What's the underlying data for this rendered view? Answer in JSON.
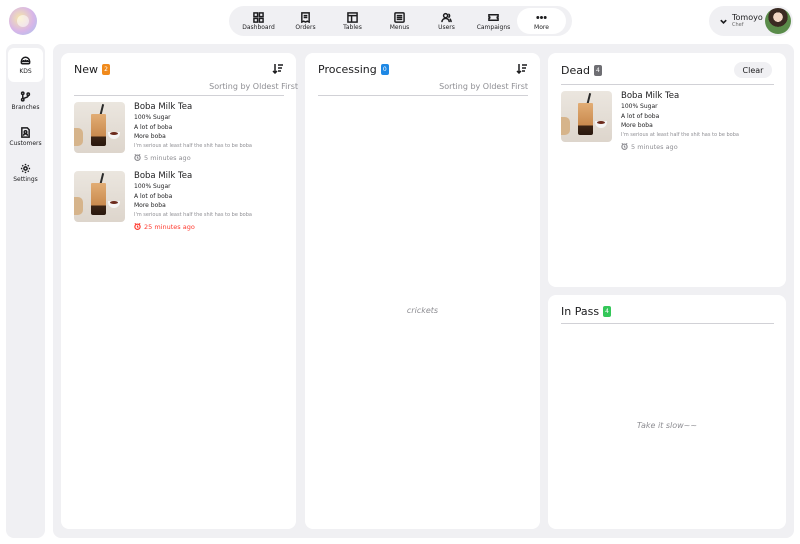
{
  "nav": {
    "items": [
      {
        "label": "Dashboard",
        "icon": "dashboard-icon"
      },
      {
        "label": "Orders",
        "icon": "receipt-icon"
      },
      {
        "label": "Tables",
        "icon": "table-icon"
      },
      {
        "label": "Menus",
        "icon": "menu-icon"
      },
      {
        "label": "Users",
        "icon": "users-icon"
      },
      {
        "label": "Campaigns",
        "icon": "ticket-icon"
      },
      {
        "label": "More",
        "icon": "more-icon"
      }
    ]
  },
  "user": {
    "name": "Tomoyo",
    "role": "Chef"
  },
  "sidebar": {
    "items": [
      {
        "label": "KDS",
        "icon": "kds-icon"
      },
      {
        "label": "Branches",
        "icon": "branches-icon"
      },
      {
        "label": "Customers",
        "icon": "customers-icon"
      },
      {
        "label": "Settings",
        "icon": "settings-icon"
      }
    ]
  },
  "panels": {
    "new": {
      "title": "New",
      "count": "2",
      "badge_color": "#f08a1c",
      "sort": "Sorting by Oldest First",
      "orders": [
        {
          "name": "Boba Milk Tea",
          "lines": [
            "100% Sugar",
            "A lot of boba",
            "More boba"
          ],
          "note": "I'm serious at least half the shit has to be boba",
          "time": "5 minutes ago"
        },
        {
          "name": "Boba Milk Tea",
          "lines": [
            "100% Sugar",
            "A lot of boba",
            "More boba"
          ],
          "note": "I'm serious at least half the shit has to be boba",
          "time": "25 minutes ago"
        }
      ]
    },
    "processing": {
      "title": "Processing",
      "count": "0",
      "badge_color": "#1e88e5",
      "sort": "Sorting by Oldest First",
      "empty": "crickets"
    },
    "dead": {
      "title": "Dead",
      "count": "4",
      "badge_color": "#6e6e73",
      "clear": "Clear",
      "orders": [
        {
          "name": "Boba Milk Tea",
          "lines": [
            "100% Sugar",
            "A lot of boba",
            "More boba"
          ],
          "note": "I'm serious at least half the shit has to be boba",
          "time": "5 minutes ago"
        }
      ]
    },
    "in_pass": {
      "title": "In Pass",
      "count": "4",
      "badge_color": "#34c759",
      "empty": "Take it slow~~"
    }
  }
}
